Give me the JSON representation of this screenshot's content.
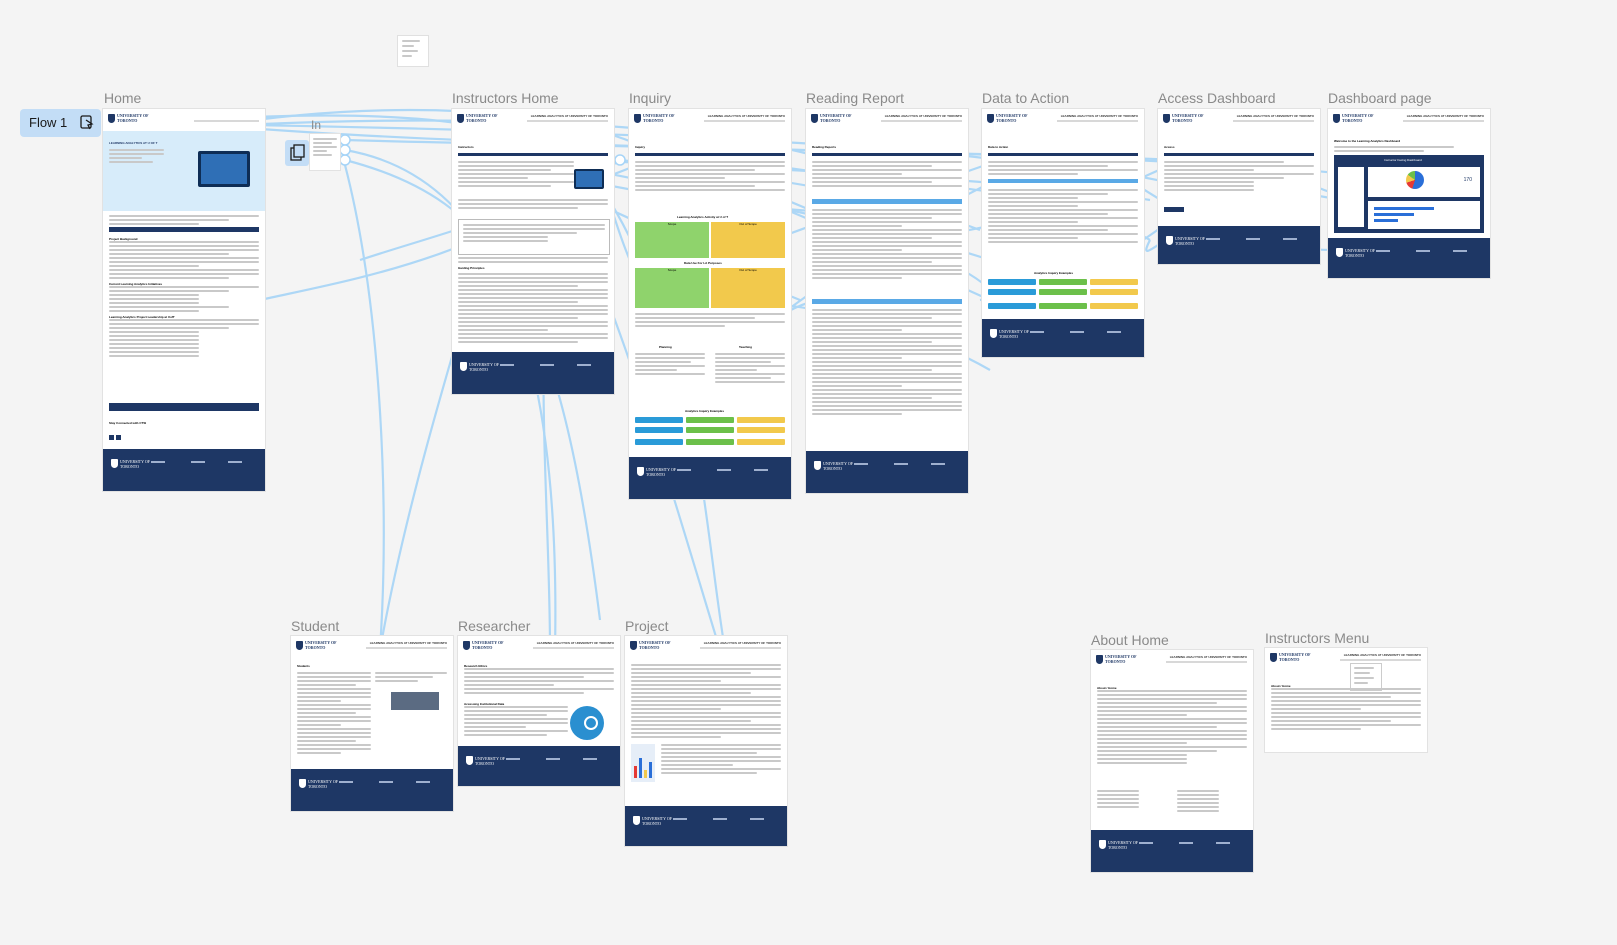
{
  "canvas": {
    "background": "#f4f4f4",
    "connector_color": "#9fd0f5",
    "accent_navy": "#1e3765"
  },
  "flow": {
    "label": "Flow 1",
    "icon": "play-frame-icon"
  },
  "header": {
    "logo_line1": "UNIVERSITY OF",
    "logo_line2": "TORONTO",
    "site_title": "LEARNING ANALYTICS AT UNIVERSITY OF TORONTO"
  },
  "frames": {
    "home": "Home",
    "in": "In",
    "instructors_home": "Instructors Home",
    "inquiry": "Inquiry",
    "reading_report": "Reading Report",
    "data_to_action": "Data to Action",
    "access_dashboard": "Access Dashboard",
    "dashboard_page": "Dashboard page",
    "student": "Student",
    "researcher": "Researcher",
    "project": "Project",
    "about_home": "About Home",
    "instructors_menu": "Instructors Menu"
  },
  "content": {
    "home_hero": "LEARNING ANALYTICS AT U OF T",
    "home_h1": "Project Background",
    "home_h2": "Current Learning Analytics Initiatives",
    "home_h3": "Learning Analytics Project Leadership at UofT",
    "home_stay": "Stay Connected with CTSI",
    "instr_h1": "Instructors",
    "instr_h2": "Guiding Principles",
    "inquiry_h1": "Inquiry",
    "inquiry_h2": "Learning Analytics Activity at U of T",
    "inquiry_h3": "Data Use For LA Purposes",
    "inquiry_h4": "Analytics Inquiry Examples",
    "inquiry_scope": "Scope",
    "inquiry_outscope": "Out of Scope",
    "inquiry_planning": "Planning",
    "inquiry_teaching": "Teaching",
    "rr_h1": "Reading Reports",
    "dta_h1": "Data to Action",
    "dta_h2": "Analytics Inquiry Examples",
    "access_h1": "Access",
    "dash_h1": "Welcome to the Learning Analytics Dashboard",
    "dash_panel": "Instructor Facing Dashboard",
    "dash_number": "170",
    "student_h1": "Students",
    "research_h1": "Research Ethics",
    "research_h2": "Accessing Institutional Data",
    "about_h1": "About / Home",
    "imenu_h1": "About / Home",
    "footer_cols": [
      "PARTNERS",
      "CONTACT",
      "ABOUT"
    ]
  }
}
